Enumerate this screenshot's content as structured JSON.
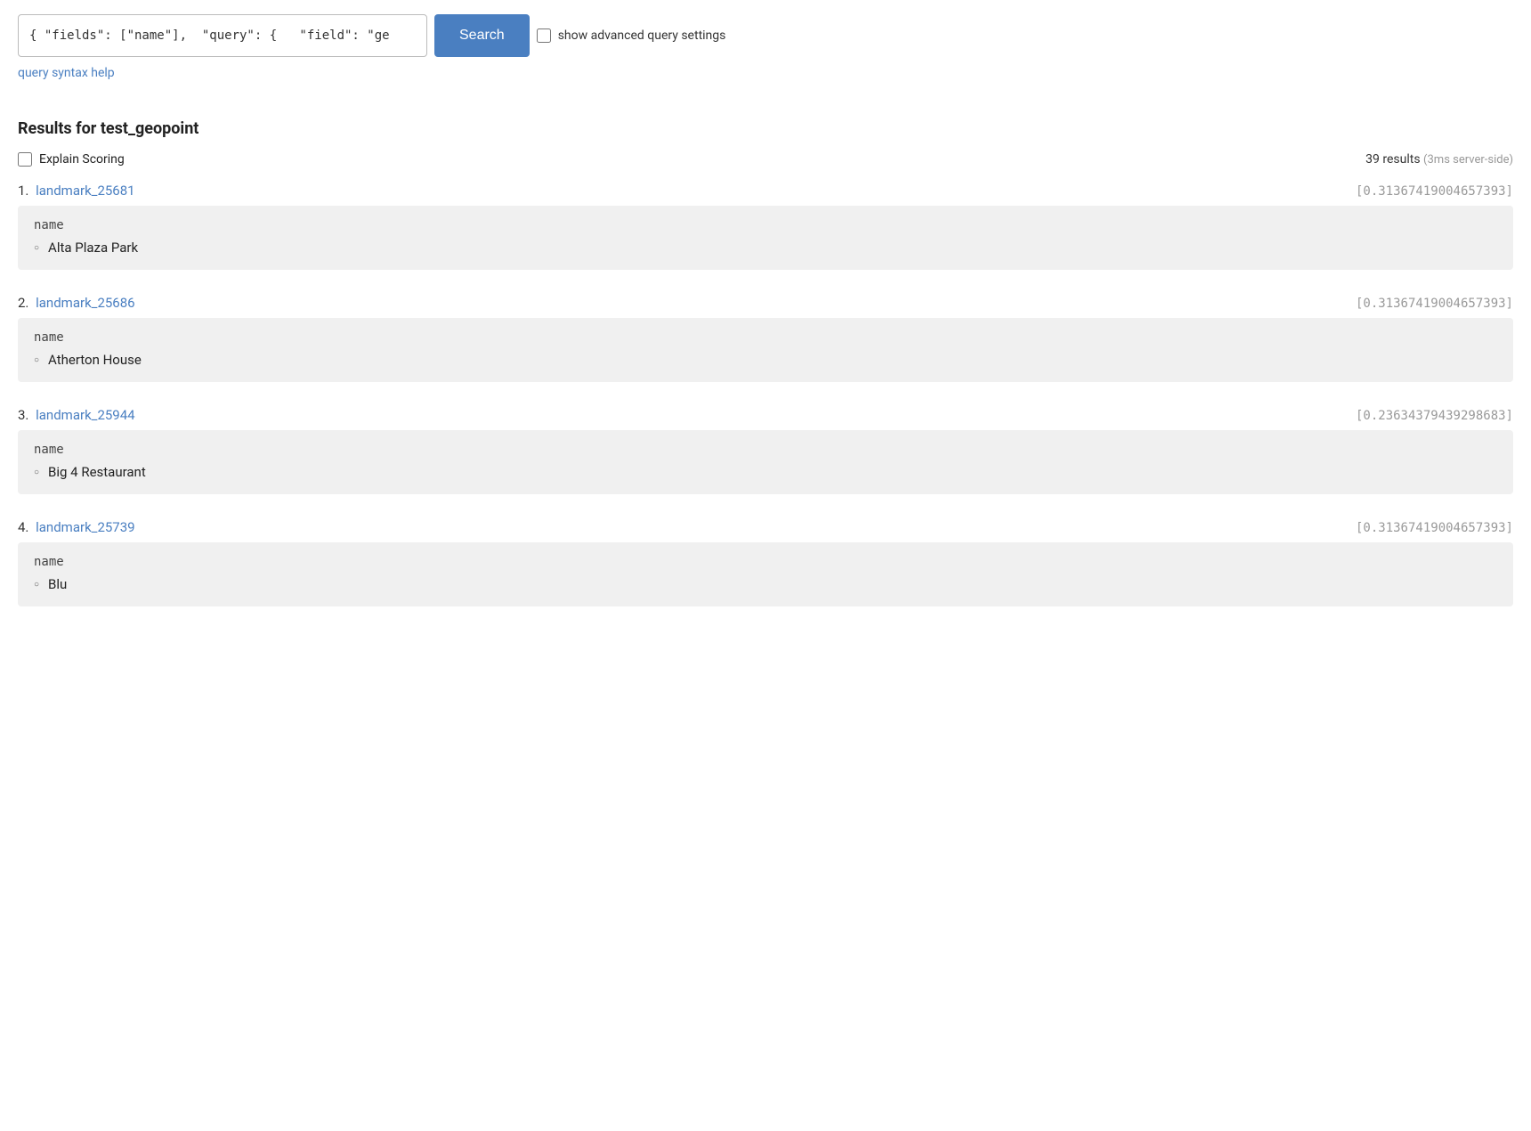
{
  "search": {
    "input_value": "{ \"fields\": [\"name\"],  \"query\": {   \"field\": \"ge",
    "input_placeholder": "",
    "button_label": "Search",
    "advanced_label": "show advanced query settings",
    "query_syntax_link": "query syntax help"
  },
  "results": {
    "heading": "Results for test_geopoint",
    "explain_label": "Explain Scoring",
    "count_text": "39 results",
    "count_server": "(3ms server-side)",
    "items": [
      {
        "number": "1.",
        "id": "landmark_25681",
        "score": "[0.31367419004657393]",
        "field_name": "name",
        "field_value": "Alta Plaza Park"
      },
      {
        "number": "2.",
        "id": "landmark_25686",
        "score": "[0.31367419004657393]",
        "field_name": "name",
        "field_value": "Atherton House"
      },
      {
        "number": "3.",
        "id": "landmark_25944",
        "score": "[0.23634379439298683]",
        "field_name": "name",
        "field_value": "Big 4 Restaurant"
      },
      {
        "number": "4.",
        "id": "landmark_25739",
        "score": "[0.31367419004657393]",
        "field_name": "name",
        "field_value": "Blu"
      }
    ]
  }
}
